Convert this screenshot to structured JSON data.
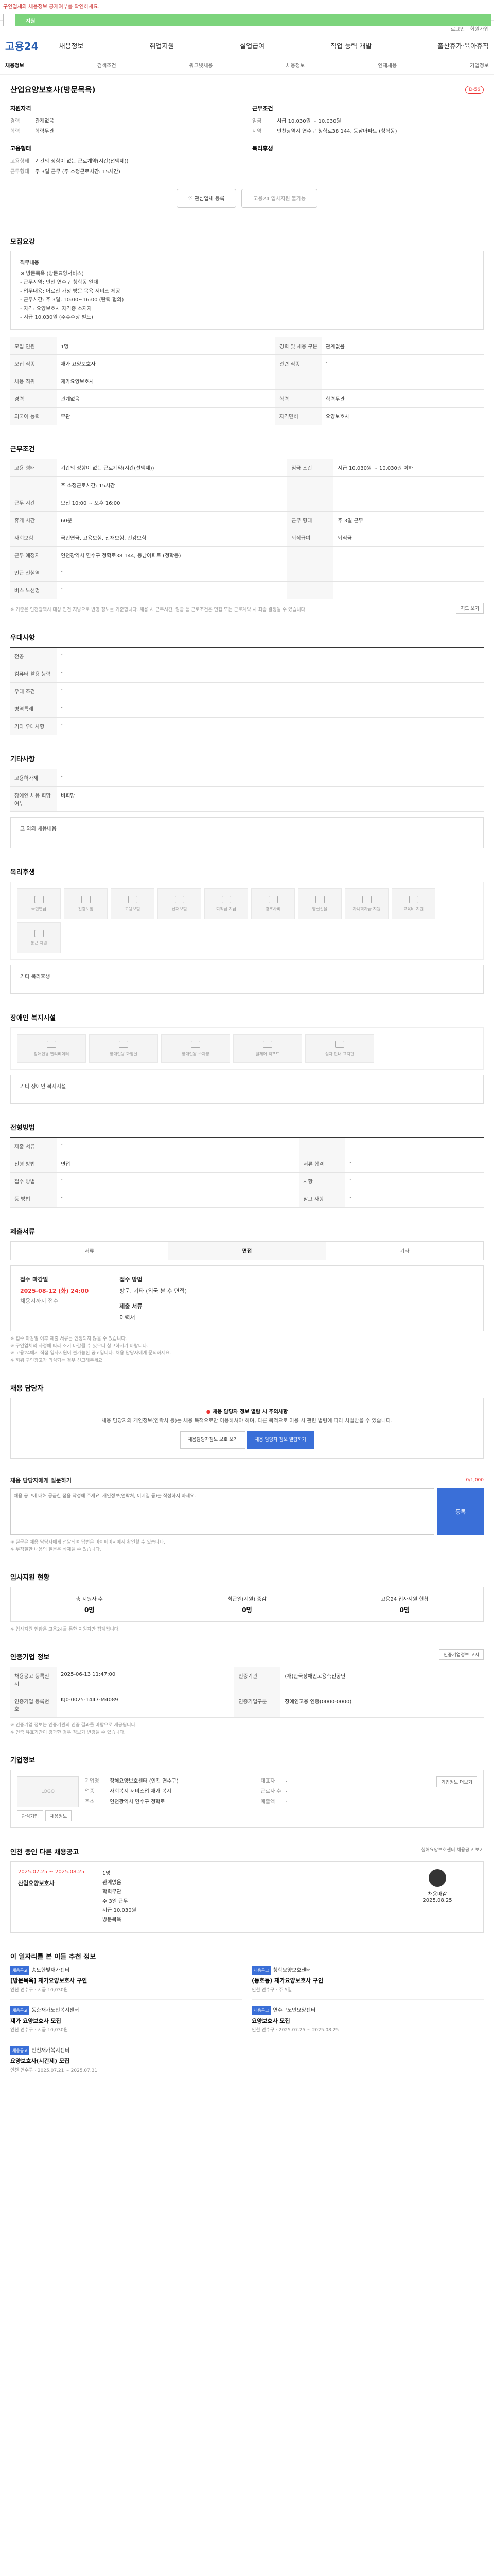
{
  "banner": {
    "notice": "구인업체의 채용정보 공개여부를 확인하세요.",
    "label": "지원"
  },
  "utility": [
    "로그인",
    "회원가입"
  ],
  "header": {
    "logo": "고용24",
    "nav": [
      "채용정보",
      "취업지원",
      "실업급여",
      "직업 능력 개발",
      "출산휴가·육아휴직"
    ]
  },
  "subnav": [
    "채용정보",
    "검색조건",
    "워크넷채용",
    "채용정보",
    "인재채용",
    "기업정보"
  ],
  "job": {
    "title": "산업요양보호사(방문목욕)",
    "dday": "D-56",
    "applicant_title": "지원자격",
    "applicant": [
      {
        "k": "경력",
        "v": "관계없음"
      },
      {
        "k": "학력",
        "v": "학력무관"
      }
    ],
    "conditions_title": "근무조건",
    "conditions": [
      {
        "k": "임금",
        "v": "시급 10,030원 ~ 10,030원"
      },
      {
        "k": "지역",
        "v": "인천광역시 연수구 청학로38 144, 동남아파트 (청학동)"
      }
    ],
    "employ_title": "고용형태",
    "employ": [
      {
        "k": "고용형태",
        "v": "기간의 정함이 없는 근로계약(시간(선택제))"
      },
      {
        "k": "근무형태",
        "v": "주 3일 근무 (주 소정근로시간: 15시간)"
      }
    ],
    "welfare_title": "복리후생",
    "btn_interest": "관심업체 등록",
    "btn_apply": "고용24 입사지원 불가능"
  },
  "sections": {
    "recruit": "모집요강",
    "conditions": "근무조건",
    "prefer": "우대사항",
    "apply": "기타사항",
    "welfare": "복리후생",
    "disabled": "장애인 복지시설",
    "method": "전형방법",
    "docs": "제출서류",
    "contact": "채용 담당자",
    "mgr_question": "채용 담당자에게 질문하기",
    "status": "입사지원 현황",
    "info": "인증기업 정보",
    "company": "기업정보",
    "region": "인천 중인 다른 채용공고",
    "others": "이 일자리를 본 이들 추천 정보"
  },
  "recruit": {
    "desc_title": "직무내용",
    "desc": "※ 방문목욕 (방문요양서비스)\n- 근무지역: 인천 연수구 청학동 일대\n- 업무내용: 어르신 가정 방문 목욕 서비스 제공\n- 근무시간: 주 3일, 10:00~16:00 (탄력 협의)\n- 자격: 요양보호사 자격증 소지자\n- 시급 10,030원 (주휴수당 별도)",
    "rows": [
      {
        "k": "모집 인원",
        "v": "1명",
        "k2": "경력 및 채용 구분",
        "v2": "관계없음"
      },
      {
        "k": "모집 직종",
        "v": "재가 요양보호사",
        "k2": "관련 직종",
        "v2": "-"
      },
      {
        "k": "채용 직위",
        "v": "재가요양보호사",
        "k2": "",
        "v2": ""
      },
      {
        "k": "경력",
        "v": "관계없음",
        "k2": "학력",
        "v2": "학력무관"
      },
      {
        "k": "외국어 능력",
        "v": "무관",
        "k2": "자격면허",
        "v2": "요양보호사"
      }
    ],
    "tag": "산업인력공단"
  },
  "work": {
    "rows": [
      {
        "k": "고용 형태",
        "v": "기간의 정함이 없는 근로계약(시간(선택제))",
        "k2": "임금 조건",
        "v2": "시급 10,030원 ~ 10,030원 이하"
      },
      {
        "k": "",
        "v": "주 소정근로시간: 15시간",
        "k2": "",
        "v2": ""
      },
      {
        "k": "근무 시간",
        "v": "오전 10:00 ~ 오후 16:00",
        "k2": "",
        "v2": ""
      },
      {
        "k": "휴게 시간",
        "v": "60분",
        "k2": "근무 형태",
        "v2": "주 3일 근무"
      },
      {
        "k": "사회보험",
        "v": "국민연금, 고용보험, 산재보험, 건강보험",
        "k2": "퇴직급여",
        "v2": "퇴직금"
      },
      {
        "k": "근무 예정지",
        "v": "인천광역시 연수구 청학로38 144, 동남아파트 (청학동)",
        "k2": "",
        "v2": ""
      },
      {
        "k": "인근 전철역",
        "v": "-",
        "k2": "",
        "v2": ""
      },
      {
        "k": "버스 노선명",
        "v": "-",
        "k2": "",
        "v2": ""
      }
    ],
    "map_button": "지도 보기",
    "note": "※ 기준은 인천광역시 대상 인천 지방으로 반영 정보를 기준합니다. 채용 시 근무시간, 임금 등 근로조건은 면접 또는 근로계약 시 최종 결정될 수 있습니다."
  },
  "prefer": {
    "rows": [
      {
        "k": "전공",
        "v": "-"
      },
      {
        "k": "컴퓨터 활용 능력",
        "v": "-"
      },
      {
        "k": "우대 조건",
        "v": "-"
      },
      {
        "k": "병역특례",
        "v": "-"
      },
      {
        "k": "기타 우대사항",
        "v": "-"
      }
    ]
  },
  "etc": {
    "rows": [
      {
        "k": "고용허가제",
        "v": "-"
      },
      {
        "k": "장애인 채용 희망 여부",
        "v": "비희망"
      }
    ],
    "sub": "그 외의 채용내용"
  },
  "welfare_cards": [
    "국민연금",
    "건강보험",
    "고용보험",
    "산재보험",
    "퇴직금 지급",
    "경조사비",
    "명절선물",
    "자녀학자금 지원",
    "교육비 지원",
    "통근 지원"
  ],
  "welfare_sub": "기타 복리후생",
  "disabled_cards": [
    "장애인용 엘리베이터",
    "장애인용 화장실",
    "장애인용 주차장",
    "휠체어 리프트",
    "점자 안내 표지판"
  ],
  "disabled_sub": "기타 장애인 복지시설",
  "method": {
    "rows": [
      {
        "k": "제출 서류",
        "v": "-",
        "k2": "",
        "v2": ""
      },
      {
        "k": "전형 방법",
        "v": "면접",
        "k2": "서류 합격",
        "v2": "-"
      },
      {
        "k": "접수 방법",
        "v": "-",
        "k2": "사항",
        "v2": "-"
      },
      {
        "k": "등 방법",
        "v": "-",
        "k2": "참고 사항",
        "v2": "-"
      }
    ]
  },
  "docs": {
    "tabs": [
      "서류",
      "면접",
      "기타"
    ],
    "deadline_label": "접수 마감일",
    "deadline": "2025-08-12 (화) 24:00",
    "deadline_note": "채용시까지 접수",
    "method_label": "접수 방법",
    "method": "방문, 기타 (외국 본 후 면접)",
    "docs_label": "제출 서류",
    "docs_value": "이력서",
    "notes": [
      "※ 접수 마감일 이후 제출 서류는 인정되지 않을 수 있습니다.",
      "※ 구인업체의 사정에 따라 조기 마감될 수 있으니 참고하시기 바랍니다.",
      "※ 고용24에서 직접 입사지원이 불가능한 공고입니다. 채용 담당자에게 문의하세요.",
      "※ 허위 구인광고가 의심되는 경우 신고해주세요."
    ]
  },
  "contact": {
    "warn_title": "채용 담당자 정보 열람 시 주의사항",
    "warn_body": "채용 담당자의 개인정보(연락처 등)는 채용 목적으로만 이용하셔야 하며, 다른 목적으로 이용 시 관련 법령에 따라 처벌받을 수 있습니다.",
    "btn_view": "채용담당자정보 보호 보기",
    "btn_confirm": "채용 담당자 정보 열람하기"
  },
  "question": {
    "label": "채용 담당자에게 질문하기",
    "counter": "0/1,000",
    "placeholder": "채용 공고에 대해 궁금한 점을 작성해 주세요. 개인정보(연락처, 이메일 등)는 작성하지 마세요.",
    "submit": "등록",
    "notes": [
      "※ 질문은 채용 담당자에게 전달되며 답변은 마이페이지에서 확인할 수 있습니다.",
      "※ 부적절한 내용의 질문은 삭제될 수 있습니다."
    ]
  },
  "status": {
    "items": [
      {
        "label": "총 지원자 수",
        "value": "0명"
      },
      {
        "label": "최근일(지원) 증감",
        "value": "0명"
      },
      {
        "label": "고용24 입사지원 현황",
        "value": "0명"
      }
    ],
    "note": "※ 입사지원 현황은 고용24를 통한 지원자만 집계됩니다."
  },
  "certinfo": {
    "button": "인증기업정보 고시",
    "rows": [
      {
        "k": "채용공고 등록일시",
        "v": "2025-06-13 11:47:00",
        "k2": "인증기관",
        "v2": "(재)한국장애인고용촉진공단"
      },
      {
        "k": "인증기업 등록번호",
        "v": "KJ0-0025-1447-M4089",
        "k2": "인증기업구분",
        "v2": "장애인고용 인증(0000-0000)"
      }
    ],
    "notes": [
      "※ 인증기업 정보는 인증기관의 인증 결과를 바탕으로 제공됩니다.",
      "※ 인증 유효기간이 경과한 경우 정보가 변경될 수 있습니다."
    ]
  },
  "company": {
    "logo": "LOGO",
    "btns": [
      "관심기업",
      "채용정보"
    ],
    "name_k": "기업명",
    "name_v": "청해요양보호센터 (인천 연수구)",
    "ceo_k": "대표자",
    "ceo_v": "-",
    "biz_k": "업종",
    "biz_v": "사회복지 서비스업 재가 복지",
    "addr_k": "주소",
    "addr_v": "인천광역시 연수구 청학로",
    "emp_k": "근로자 수",
    "emp_v": "-",
    "sales_k": "매출액",
    "sales_v": "-",
    "more": "기업정보 더보기"
  },
  "region": {
    "link": "청해요양보호센터 채용공고 보기",
    "date_label": "2025.07.25 ~ 2025.08.25",
    "title": "산업요양보호사",
    "meta": [
      "1명",
      "관계없음",
      "학력무관",
      "주 3일 근무",
      "시급 10,030원",
      "방문목욕"
    ],
    "right_label": "채용마감",
    "right_date": "2025.08.25"
  },
  "others": [
    {
      "badge": "채용공고",
      "company": "송도한빛재가센터",
      "title": "[방문목욕] 재가요양보호사 구인",
      "meta": "인천 연수구 · 시급 10,030원"
    },
    {
      "badge": "채용공고",
      "company": "청학요양보호센터",
      "title": "(동호동) 재가요양보호사 구인",
      "meta": "인천 연수구 · 주 5일"
    },
    {
      "badge": "채용공고",
      "company": "동춘재가노인복지센터",
      "title": "재가 요양보호사 모집",
      "meta": "인천 연수구 · 시급 10,030원"
    },
    {
      "badge": "채용공고",
      "company": "연수구노인요양센터",
      "title": "요양보호사 모집",
      "meta": "인천 연수구 · 2025.07.25 ~ 2025.08.25"
    },
    {
      "badge": "채용공고",
      "company": "인천재가복지센터",
      "title": "요양보호사(시간제) 모집",
      "meta": "인천 연수구 · 2025.07.21 ~ 2025.07.31"
    }
  ]
}
